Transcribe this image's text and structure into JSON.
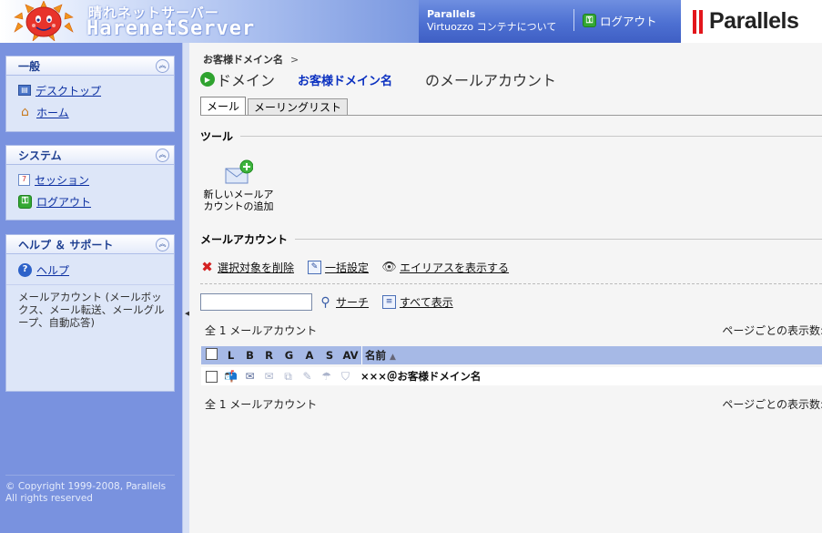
{
  "header": {
    "logo_line1": "晴れネットサーバー",
    "logo_line2": "HarenetServer",
    "about_line1": "Parallels",
    "about_line2": "Virtuozzo コンテナについて",
    "logout_label": "ログアウト",
    "brand": "Parallels"
  },
  "sidebar": {
    "general": {
      "title": "一般",
      "items": [
        {
          "label": "デスクトップ",
          "icon": "desktop-icon"
        },
        {
          "label": "ホーム",
          "icon": "home-icon"
        }
      ]
    },
    "system": {
      "title": "システム",
      "items": [
        {
          "label": "セッション",
          "icon": "session-icon"
        },
        {
          "label": "ログアウト",
          "icon": "logout-icon"
        }
      ]
    },
    "help": {
      "title": "ヘルプ ＆ サポート",
      "items": [
        {
          "label": "ヘルプ",
          "icon": "help-icon"
        }
      ],
      "description": "メールアカウント (メールボックス、メール転送、メールグループ、自動応答)"
    },
    "copyright_line1": "© Copyright 1999-2008, Parallels",
    "copyright_line2": "All rights reserved"
  },
  "main": {
    "breadcrumb": "お客様ドメイン名",
    "breadcrumb_sep": ">",
    "title_prefix": "ドメイン",
    "title_domain": "お客様ドメイン名",
    "title_suffix": "のメールアカウント",
    "tabs": [
      {
        "label": "メール",
        "active": true
      },
      {
        "label": "メーリングリスト",
        "active": false
      }
    ],
    "tools_title": "ツール",
    "new_account_line1": "新しいメールア",
    "new_account_line2": "カウントの追加",
    "accounts_title": "メールアカウント",
    "actions": {
      "delete_selected": "選択対象を削除",
      "bulk_settings": "一括設定",
      "show_aliases": "エイリアスを表示する"
    },
    "search": {
      "placeholder": "",
      "search_label": "サーチ",
      "show_all_label": "すべて表示"
    },
    "total_label": "全 1 メールアカウント",
    "per_page_label": "ページごとの表示数:",
    "table": {
      "columns": [
        "L",
        "B",
        "R",
        "G",
        "A",
        "S",
        "AV",
        "名前"
      ],
      "sort_indicator": "▲",
      "rows": [
        {
          "name": "×××＠お客様ドメイン名"
        }
      ]
    }
  },
  "colors": {
    "header_blue": "#4d70d2",
    "sidebar_blue": "#7992df",
    "table_header": "#a6b9e6",
    "link_blue": "#0b2fa1",
    "brand_red": "#e3161c"
  }
}
